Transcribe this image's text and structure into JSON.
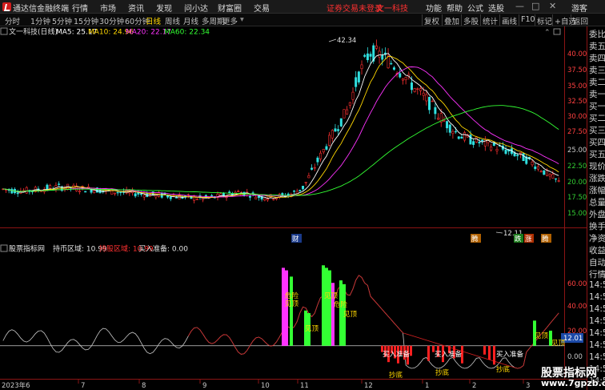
{
  "titlebar": {
    "app_name": "通达信金融终端",
    "menu": [
      "行情",
      "市场",
      "资讯",
      "发现",
      "问小达",
      "财富圈",
      "交易"
    ],
    "notice": "证券交易未登录",
    "notice_stock": "文一科技",
    "functions": [
      "功能",
      "帮助",
      "公式",
      "选股"
    ],
    "guest": "游客",
    "minimize": "—",
    "maximize": "□",
    "close": "✕"
  },
  "period_tabs": {
    "items": [
      "分时",
      "1分钟",
      "5分钟",
      "15分钟",
      "30分钟",
      "60分钟",
      "日线",
      "周线",
      "月线",
      "多周期",
      "更多"
    ],
    "active": "日线",
    "tools": [
      "复权",
      "叠加",
      "多股",
      "统计",
      "画线",
      "F10",
      "标记",
      "+自选",
      "返回"
    ]
  },
  "main_legend": {
    "stock": "文一科技(日线)",
    "ma5": "MA5: 25.17",
    "ma10": "MA10: 24.96",
    "ma20": "MA20: 22.17",
    "ma60": "MA60: 22.34",
    "colors": {
      "ma5": "#ffffff",
      "ma10": "#ffd700",
      "ma20": "#ff33ff",
      "ma60": "#33ff33"
    }
  },
  "price_axis": {
    "labels": [
      "40.00",
      "37.50",
      "35.00",
      "32.50",
      "30.00",
      "27.50",
      "25.00",
      "22.50",
      "20.00",
      "17.50",
      "15.00"
    ],
    "high_label": "42.34",
    "low_label": "12.11"
  },
  "event_markers": [
    "财",
    "腾",
    "跌",
    "涨",
    "腾"
  ],
  "sub_legend": {
    "indicator": "股票指标网",
    "hold_label": "持币区域: 10.99",
    "hold_area": "持股区域: 10.99",
    "buy_prep": "买入准备: 0.00"
  },
  "sub_axis": {
    "labels": [
      "60.00",
      "40.00",
      "20.00",
      "0.00"
    ],
    "current_value": "12.01"
  },
  "sub_signals": {
    "tops": [
      "危险",
      "见顶",
      "危险",
      "见顶",
      "危险",
      "见顶"
    ],
    "buy_prep": [
      "买入准备",
      "买入准备",
      "买入准备"
    ],
    "bottoms": [
      "抄底",
      "抄底",
      "抄底"
    ],
    "top_right": [
      "见顶",
      "见顶"
    ]
  },
  "date_axis": [
    "2023年6",
    "7",
    "8",
    "9",
    "10",
    "11",
    "12",
    "1",
    "2",
    "3"
  ],
  "quote_column": [
    "委比",
    "卖五",
    "卖四",
    "卖三",
    "卖二",
    "卖一",
    "买一",
    "买二",
    "买三",
    "买四",
    "买五",
    "现价",
    "涨跌",
    "涨幅",
    "总量",
    "外盘",
    "换手",
    "净资",
    "收益",
    "自动",
    "行情",
    "14:50",
    "14:50",
    "14:50",
    "14:50",
    "14:50",
    "14:50",
    "14:50",
    "14:50",
    "14:50"
  ],
  "watermark": {
    "line1": "股票指标网",
    "line2": "www.7gpzb.com"
  },
  "chart_data": {
    "type": "candlestick",
    "price_range": [
      11.0,
      43.5
    ],
    "note_sub_range": [
      -25,
      68
    ],
    "main_line": [
      [
        0,
        17.2
      ],
      [
        0.02,
        17.0
      ],
      [
        0.04,
        16.9
      ],
      [
        0.06,
        17.1
      ],
      [
        0.08,
        17.4
      ],
      [
        0.1,
        17.6
      ],
      [
        0.12,
        17.5
      ],
      [
        0.14,
        17.3
      ],
      [
        0.16,
        17.2
      ],
      [
        0.18,
        17.0
      ],
      [
        0.2,
        16.8
      ],
      [
        0.22,
        16.6
      ],
      [
        0.24,
        16.5
      ],
      [
        0.26,
        16.3
      ],
      [
        0.28,
        16.2
      ],
      [
        0.3,
        16.1
      ],
      [
        0.32,
        15.9
      ],
      [
        0.34,
        15.7
      ],
      [
        0.36,
        15.6
      ],
      [
        0.38,
        15.8
      ],
      [
        0.4,
        16.2
      ],
      [
        0.42,
        16.7
      ],
      [
        0.44,
        16.5
      ],
      [
        0.46,
        15.9
      ],
      [
        0.48,
        15.8
      ],
      [
        0.5,
        16.0
      ],
      [
        0.52,
        16.4
      ],
      [
        0.54,
        17.5
      ],
      [
        0.56,
        21.0
      ],
      [
        0.58,
        24.5
      ],
      [
        0.6,
        27.8
      ],
      [
        0.62,
        31.0
      ],
      [
        0.64,
        37.0
      ],
      [
        0.66,
        41.0
      ],
      [
        0.68,
        40.5
      ],
      [
        0.7,
        39.0
      ],
      [
        0.72,
        37.2
      ],
      [
        0.74,
        34.8
      ],
      [
        0.76,
        33.0
      ],
      [
        0.78,
        30.5
      ],
      [
        0.8,
        28.4
      ],
      [
        0.82,
        26.7
      ],
      [
        0.84,
        25.8
      ],
      [
        0.86,
        25.3
      ],
      [
        0.88,
        24.8
      ],
      [
        0.9,
        24.1
      ],
      [
        0.92,
        23.4
      ],
      [
        0.94,
        22.5
      ],
      [
        0.96,
        21.3
      ],
      [
        0.98,
        19.8
      ],
      [
        1.0,
        18.4
      ]
    ]
  }
}
